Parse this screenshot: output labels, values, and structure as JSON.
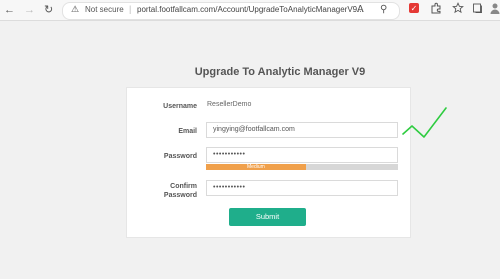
{
  "browser": {
    "back_glyph": "←",
    "forward_glyph": "→",
    "reload_glyph": "↻",
    "security_text": "Not secure",
    "url": "portal.footfallcam.com/Account/UpgradeToAnalyticManagerV9...",
    "read_aloud_glyph": "A",
    "zoom_glyph": "⚲"
  },
  "page": {
    "title": "Upgrade To Analytic Manager V9"
  },
  "form": {
    "username_label": "Username",
    "username_value": "ResellerDemo",
    "email_label": "Email",
    "email_value": "yingying@footfallcam.com",
    "password_label": "Password",
    "password_value": "•••••••••••",
    "strength_label": "Medium",
    "strength_fraction": 0.52,
    "confirm_label_line1": "Confirm",
    "confirm_label_line2": "Password",
    "confirm_value": "•••••••••••",
    "submit_label": "Submit"
  },
  "colors": {
    "accent": "#1fae8b",
    "strength_fill": "#f0a04b",
    "annotation": "#2ecc40"
  },
  "icons": [
    "back-icon",
    "forward-icon",
    "warning-icon",
    "read-aloud-icon",
    "extension-icon",
    "favorites-icon",
    "collections-icon",
    "profile-icon",
    "checkmark-icon"
  ]
}
